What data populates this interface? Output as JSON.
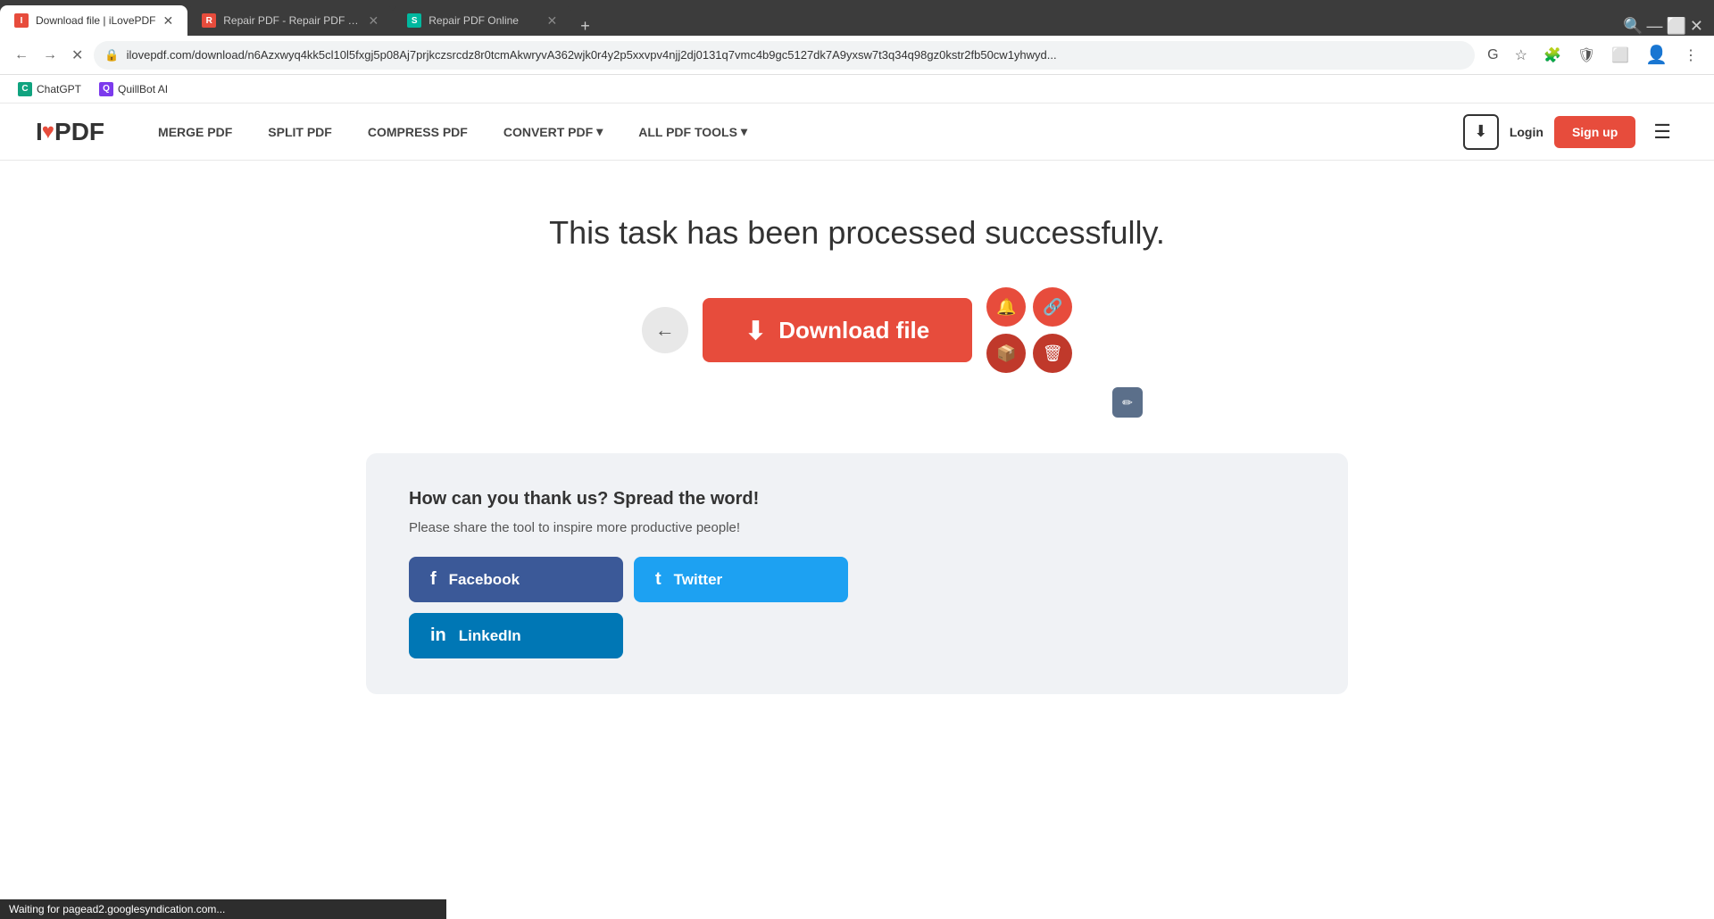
{
  "browser": {
    "tabs": [
      {
        "id": "tab1",
        "title": "Download file | iLovePDF",
        "favicon_color": "#e74c3c",
        "favicon_letter": "I",
        "active": true
      },
      {
        "id": "tab2",
        "title": "Repair PDF - Repair PDF online",
        "favicon_color": "#e74c3c",
        "favicon_letter": "R",
        "active": false
      },
      {
        "id": "tab3",
        "title": "Repair PDF Online",
        "favicon_color": "#00b89f",
        "favicon_letter": "S",
        "active": false
      }
    ],
    "new_tab_label": "+",
    "address": "ilovepdf.com/download/n6Azxwyq4kk5cl10l5fxgj5p08Aj7prjkczsrcdz8r0tcmAkwryvA362wjk0r4y2p5xxvpv4njj2dj0131q7vmc4b9gc5127dk7A9yxsw7t3q34q98gz0kstr2fb50cw1yhwyd...",
    "nav_back_disabled": false,
    "nav_forward_disabled": true
  },
  "bookmarks": [
    {
      "label": "ChatGPT",
      "icon_color": "#10a37f",
      "icon_letter": "C"
    },
    {
      "label": "QuillBot AI",
      "icon_color": "#7c3aed",
      "icon_letter": "Q"
    }
  ],
  "nav": {
    "logo_i": "I",
    "logo_love": "♥",
    "logo_pdf": "PDF",
    "links": [
      {
        "label": "MERGE PDF",
        "dropdown": false
      },
      {
        "label": "SPLIT PDF",
        "dropdown": false
      },
      {
        "label": "COMPRESS PDF",
        "dropdown": false
      },
      {
        "label": "CONVERT PDF",
        "dropdown": true
      },
      {
        "label": "ALL PDF TOOLS",
        "dropdown": true
      }
    ],
    "login_label": "Login",
    "signup_label": "Sign up",
    "download_desktop_label": "⬇"
  },
  "main": {
    "success_message": "This task has been processed successfully.",
    "download_button_label": "Download file",
    "back_button_icon": "←",
    "download_icon": "⬇",
    "action_icons": {
      "notify": "🔔",
      "link": "🔗",
      "dropbox": "📦",
      "delete": "🗑",
      "edit": "✏"
    }
  },
  "share": {
    "title": "How can you thank us? Spread the word!",
    "subtitle": "Please share the tool to inspire more productive people!",
    "facebook_label": "Facebook",
    "twitter_label": "Twitter",
    "linkedin_label": "LinkedIn",
    "facebook_icon": "f",
    "twitter_icon": "t",
    "linkedin_icon": "in"
  },
  "status_bar": {
    "text": "Waiting for pagead2.googlesyndication.com..."
  }
}
